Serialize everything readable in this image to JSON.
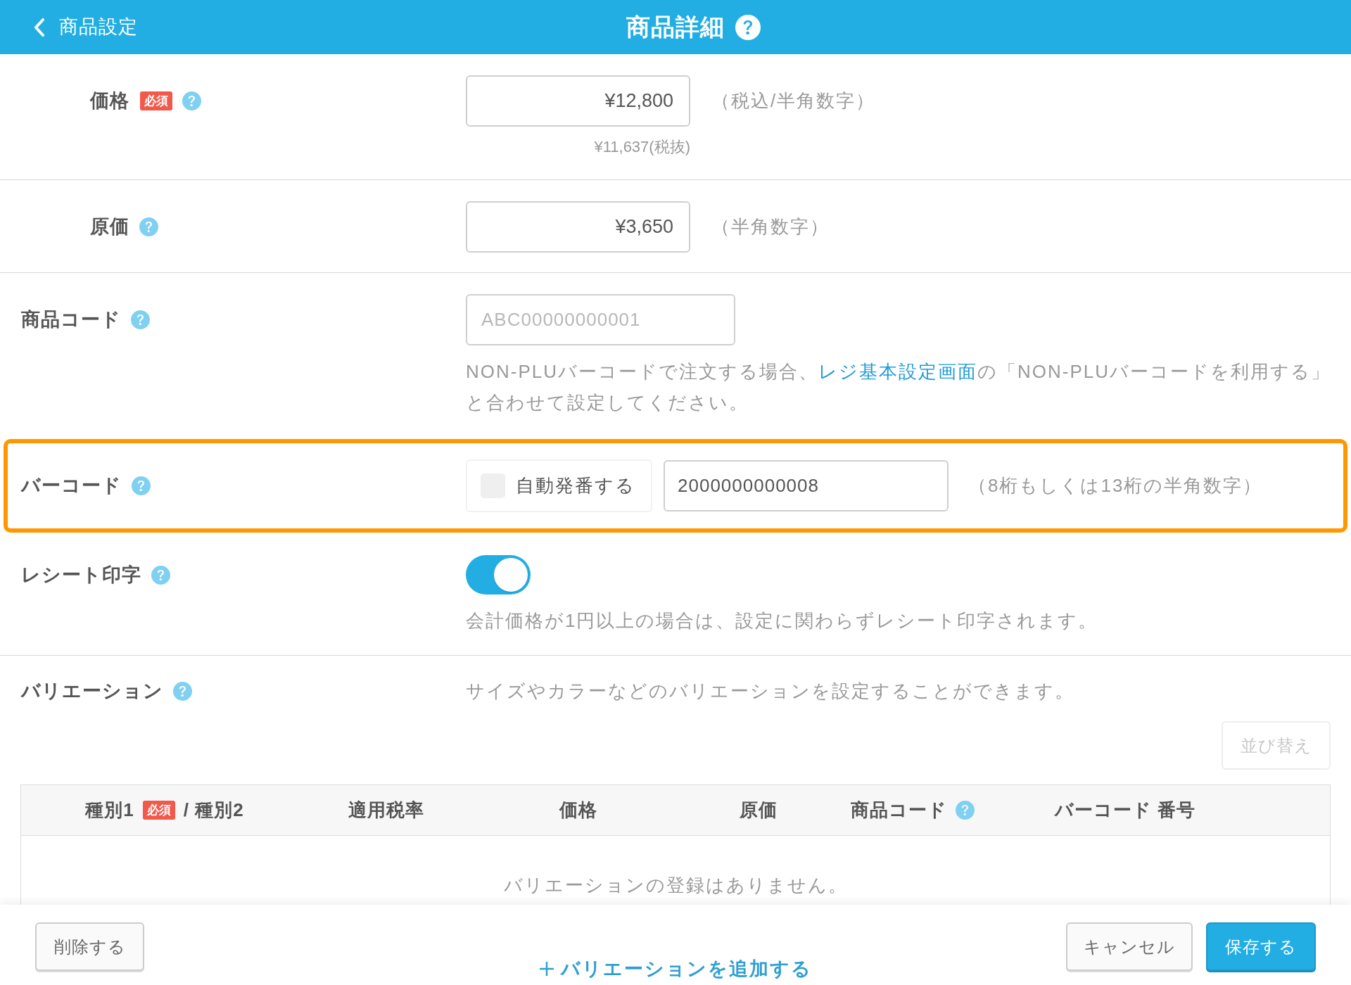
{
  "header": {
    "back_label": "商品設定",
    "title": "商品詳細"
  },
  "fields": [
    {
      "kind": "amount",
      "label": "価格",
      "badge": "必須",
      "value": "¥12,800",
      "hint": "（税込/半角数字）",
      "sub_value": "¥11,637(税抜)"
    },
    {
      "kind": "amount",
      "label": "原価",
      "value": "¥3,650",
      "hint": "（半角数字）"
    },
    {
      "kind": "code",
      "label": "商品コード",
      "placeholder": "ABC00000000001",
      "note": {
        "before": "NON-PLUバーコードで注文する場合、",
        "link": "レジ基本設定画面",
        "after": "の「NON-PLUバーコードを利用する」",
        "second_line": "と合わせて設定してください。"
      }
    },
    {
      "kind": "barcode",
      "label": "バーコード",
      "highlighted": true,
      "auto_number": {
        "label": "自動発番する",
        "checked": false
      },
      "value": "2000000000008",
      "hint": "（8桁もしくは13桁の半角数字）"
    },
    {
      "kind": "toggle",
      "label": "レシート印字",
      "on": true,
      "note": "会計価格が1円以上の場合は、設定に関わらずレシート印字されます。"
    }
  ],
  "variations": {
    "label": "バリエーション",
    "description": "サイズやカラーなどのバリエーションを設定することができます。",
    "sort_button": {
      "label": "並び替え",
      "disabled": true
    },
    "table": {
      "columns": [
        {
          "label": "種別1",
          "badge": "必須",
          "suffix": "/ 種別2",
          "help": false
        },
        {
          "label": "適用税率",
          "help": false
        },
        {
          "label": "価格",
          "help": false
        },
        {
          "label": "原価",
          "help": false
        },
        {
          "label": "商品コード",
          "help": true
        },
        {
          "label": "バーコード 番号",
          "help": false
        }
      ],
      "empty_message": "バリエーションの登録はありません。"
    },
    "add_button": "バリエーションを追加する"
  },
  "footer": {
    "delete_button": "削除する",
    "cancel_button": "キャンセル",
    "save_button": "保存する"
  }
}
